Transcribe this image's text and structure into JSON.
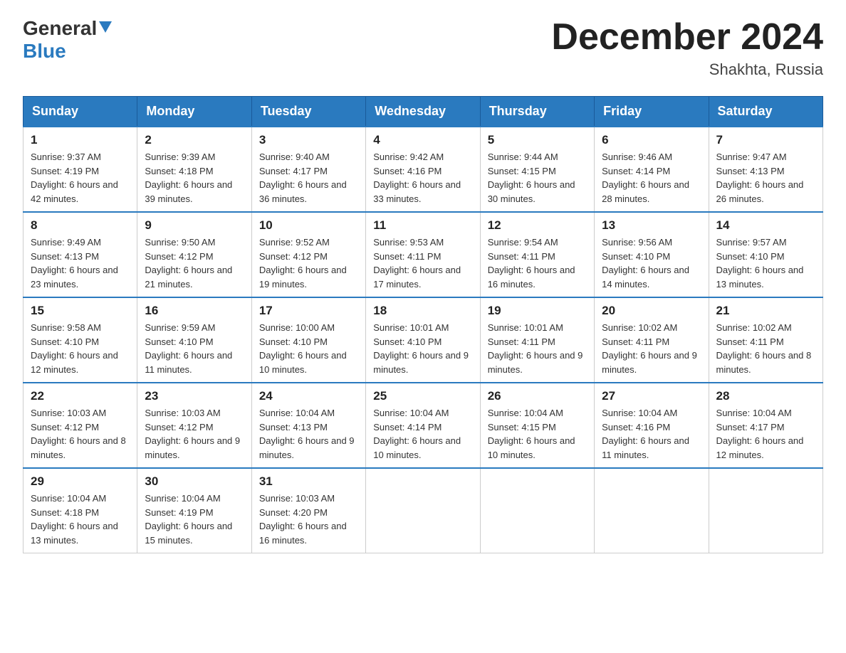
{
  "logo": {
    "general": "General",
    "blue": "Blue",
    "triangle": "▲"
  },
  "title": {
    "month": "December 2024",
    "location": "Shakhta, Russia"
  },
  "weekdays": [
    "Sunday",
    "Monday",
    "Tuesday",
    "Wednesday",
    "Thursday",
    "Friday",
    "Saturday"
  ],
  "weeks": [
    [
      {
        "day": "1",
        "sunrise": "9:37 AM",
        "sunset": "4:19 PM",
        "daylight": "6 hours and 42 minutes."
      },
      {
        "day": "2",
        "sunrise": "9:39 AM",
        "sunset": "4:18 PM",
        "daylight": "6 hours and 39 minutes."
      },
      {
        "day": "3",
        "sunrise": "9:40 AM",
        "sunset": "4:17 PM",
        "daylight": "6 hours and 36 minutes."
      },
      {
        "day": "4",
        "sunrise": "9:42 AM",
        "sunset": "4:16 PM",
        "daylight": "6 hours and 33 minutes."
      },
      {
        "day": "5",
        "sunrise": "9:44 AM",
        "sunset": "4:15 PM",
        "daylight": "6 hours and 30 minutes."
      },
      {
        "day": "6",
        "sunrise": "9:46 AM",
        "sunset": "4:14 PM",
        "daylight": "6 hours and 28 minutes."
      },
      {
        "day": "7",
        "sunrise": "9:47 AM",
        "sunset": "4:13 PM",
        "daylight": "6 hours and 26 minutes."
      }
    ],
    [
      {
        "day": "8",
        "sunrise": "9:49 AM",
        "sunset": "4:13 PM",
        "daylight": "6 hours and 23 minutes."
      },
      {
        "day": "9",
        "sunrise": "9:50 AM",
        "sunset": "4:12 PM",
        "daylight": "6 hours and 21 minutes."
      },
      {
        "day": "10",
        "sunrise": "9:52 AM",
        "sunset": "4:12 PM",
        "daylight": "6 hours and 19 minutes."
      },
      {
        "day": "11",
        "sunrise": "9:53 AM",
        "sunset": "4:11 PM",
        "daylight": "6 hours and 17 minutes."
      },
      {
        "day": "12",
        "sunrise": "9:54 AM",
        "sunset": "4:11 PM",
        "daylight": "6 hours and 16 minutes."
      },
      {
        "day": "13",
        "sunrise": "9:56 AM",
        "sunset": "4:10 PM",
        "daylight": "6 hours and 14 minutes."
      },
      {
        "day": "14",
        "sunrise": "9:57 AM",
        "sunset": "4:10 PM",
        "daylight": "6 hours and 13 minutes."
      }
    ],
    [
      {
        "day": "15",
        "sunrise": "9:58 AM",
        "sunset": "4:10 PM",
        "daylight": "6 hours and 12 minutes."
      },
      {
        "day": "16",
        "sunrise": "9:59 AM",
        "sunset": "4:10 PM",
        "daylight": "6 hours and 11 minutes."
      },
      {
        "day": "17",
        "sunrise": "10:00 AM",
        "sunset": "4:10 PM",
        "daylight": "6 hours and 10 minutes."
      },
      {
        "day": "18",
        "sunrise": "10:01 AM",
        "sunset": "4:10 PM",
        "daylight": "6 hours and 9 minutes."
      },
      {
        "day": "19",
        "sunrise": "10:01 AM",
        "sunset": "4:11 PM",
        "daylight": "6 hours and 9 minutes."
      },
      {
        "day": "20",
        "sunrise": "10:02 AM",
        "sunset": "4:11 PM",
        "daylight": "6 hours and 9 minutes."
      },
      {
        "day": "21",
        "sunrise": "10:02 AM",
        "sunset": "4:11 PM",
        "daylight": "6 hours and 8 minutes."
      }
    ],
    [
      {
        "day": "22",
        "sunrise": "10:03 AM",
        "sunset": "4:12 PM",
        "daylight": "6 hours and 8 minutes."
      },
      {
        "day": "23",
        "sunrise": "10:03 AM",
        "sunset": "4:12 PM",
        "daylight": "6 hours and 9 minutes."
      },
      {
        "day": "24",
        "sunrise": "10:04 AM",
        "sunset": "4:13 PM",
        "daylight": "6 hours and 9 minutes."
      },
      {
        "day": "25",
        "sunrise": "10:04 AM",
        "sunset": "4:14 PM",
        "daylight": "6 hours and 10 minutes."
      },
      {
        "day": "26",
        "sunrise": "10:04 AM",
        "sunset": "4:15 PM",
        "daylight": "6 hours and 10 minutes."
      },
      {
        "day": "27",
        "sunrise": "10:04 AM",
        "sunset": "4:16 PM",
        "daylight": "6 hours and 11 minutes."
      },
      {
        "day": "28",
        "sunrise": "10:04 AM",
        "sunset": "4:17 PM",
        "daylight": "6 hours and 12 minutes."
      }
    ],
    [
      {
        "day": "29",
        "sunrise": "10:04 AM",
        "sunset": "4:18 PM",
        "daylight": "6 hours and 13 minutes."
      },
      {
        "day": "30",
        "sunrise": "10:04 AM",
        "sunset": "4:19 PM",
        "daylight": "6 hours and 15 minutes."
      },
      {
        "day": "31",
        "sunrise": "10:03 AM",
        "sunset": "4:20 PM",
        "daylight": "6 hours and 16 minutes."
      },
      null,
      null,
      null,
      null
    ]
  ]
}
